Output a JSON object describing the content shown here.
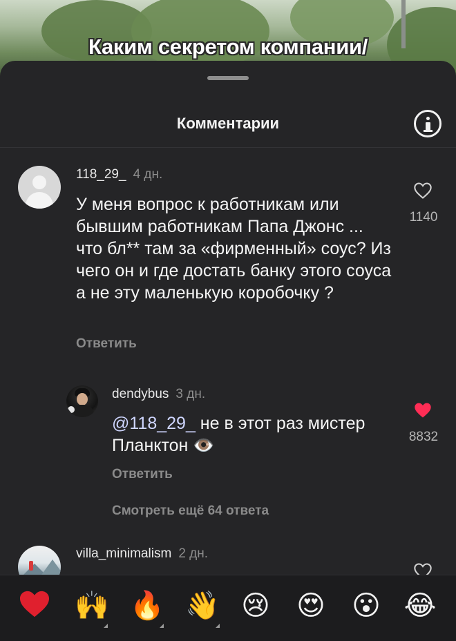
{
  "video": {
    "caption": "Каким секретом компании/"
  },
  "sheet": {
    "title": "Комментарии"
  },
  "comments": [
    {
      "username": "118_29_",
      "time": "4 дн.",
      "text": "У меня вопрос к работникам или бывшим работникам Папа Джонс ... что бл** там за «фирменный» соус? Из чего он и где достать банку этого соуса а не эту маленькую коробочку ?",
      "likes": "1140",
      "liked": false,
      "reply_label": "Ответить",
      "avatar": "default-avatar"
    }
  ],
  "reply": {
    "username": "dendybus",
    "time": "3 дн.",
    "mention": "@118_29_",
    "text": " не в этот раз мистер Планктон 👁️",
    "likes": "8832",
    "liked": true,
    "reply_label": "Ответить",
    "avatar": "photo-avatar"
  },
  "more_replies": "Смотреть ещё 64 ответа",
  "next_comment": {
    "username": "villa_minimalism",
    "time": "2 дн.",
    "avatar": "mountain-avatar"
  },
  "emoji_bar": [
    {
      "name": "red-heart",
      "glyph": "❤️"
    },
    {
      "name": "raising-hands",
      "glyph": "🙌"
    },
    {
      "name": "fire",
      "glyph": "🔥"
    },
    {
      "name": "waving-hand",
      "glyph": "👋"
    },
    {
      "name": "crying-face",
      "glyph": "😢"
    },
    {
      "name": "heart-eyes",
      "glyph": "😍"
    },
    {
      "name": "surprised-face",
      "glyph": "😮"
    },
    {
      "name": "tears-of-joy",
      "glyph": "😂"
    }
  ],
  "colors": {
    "sheet_bg": "#252527",
    "like_red": "#ff2d55",
    "mention": "#cfd6ff"
  }
}
